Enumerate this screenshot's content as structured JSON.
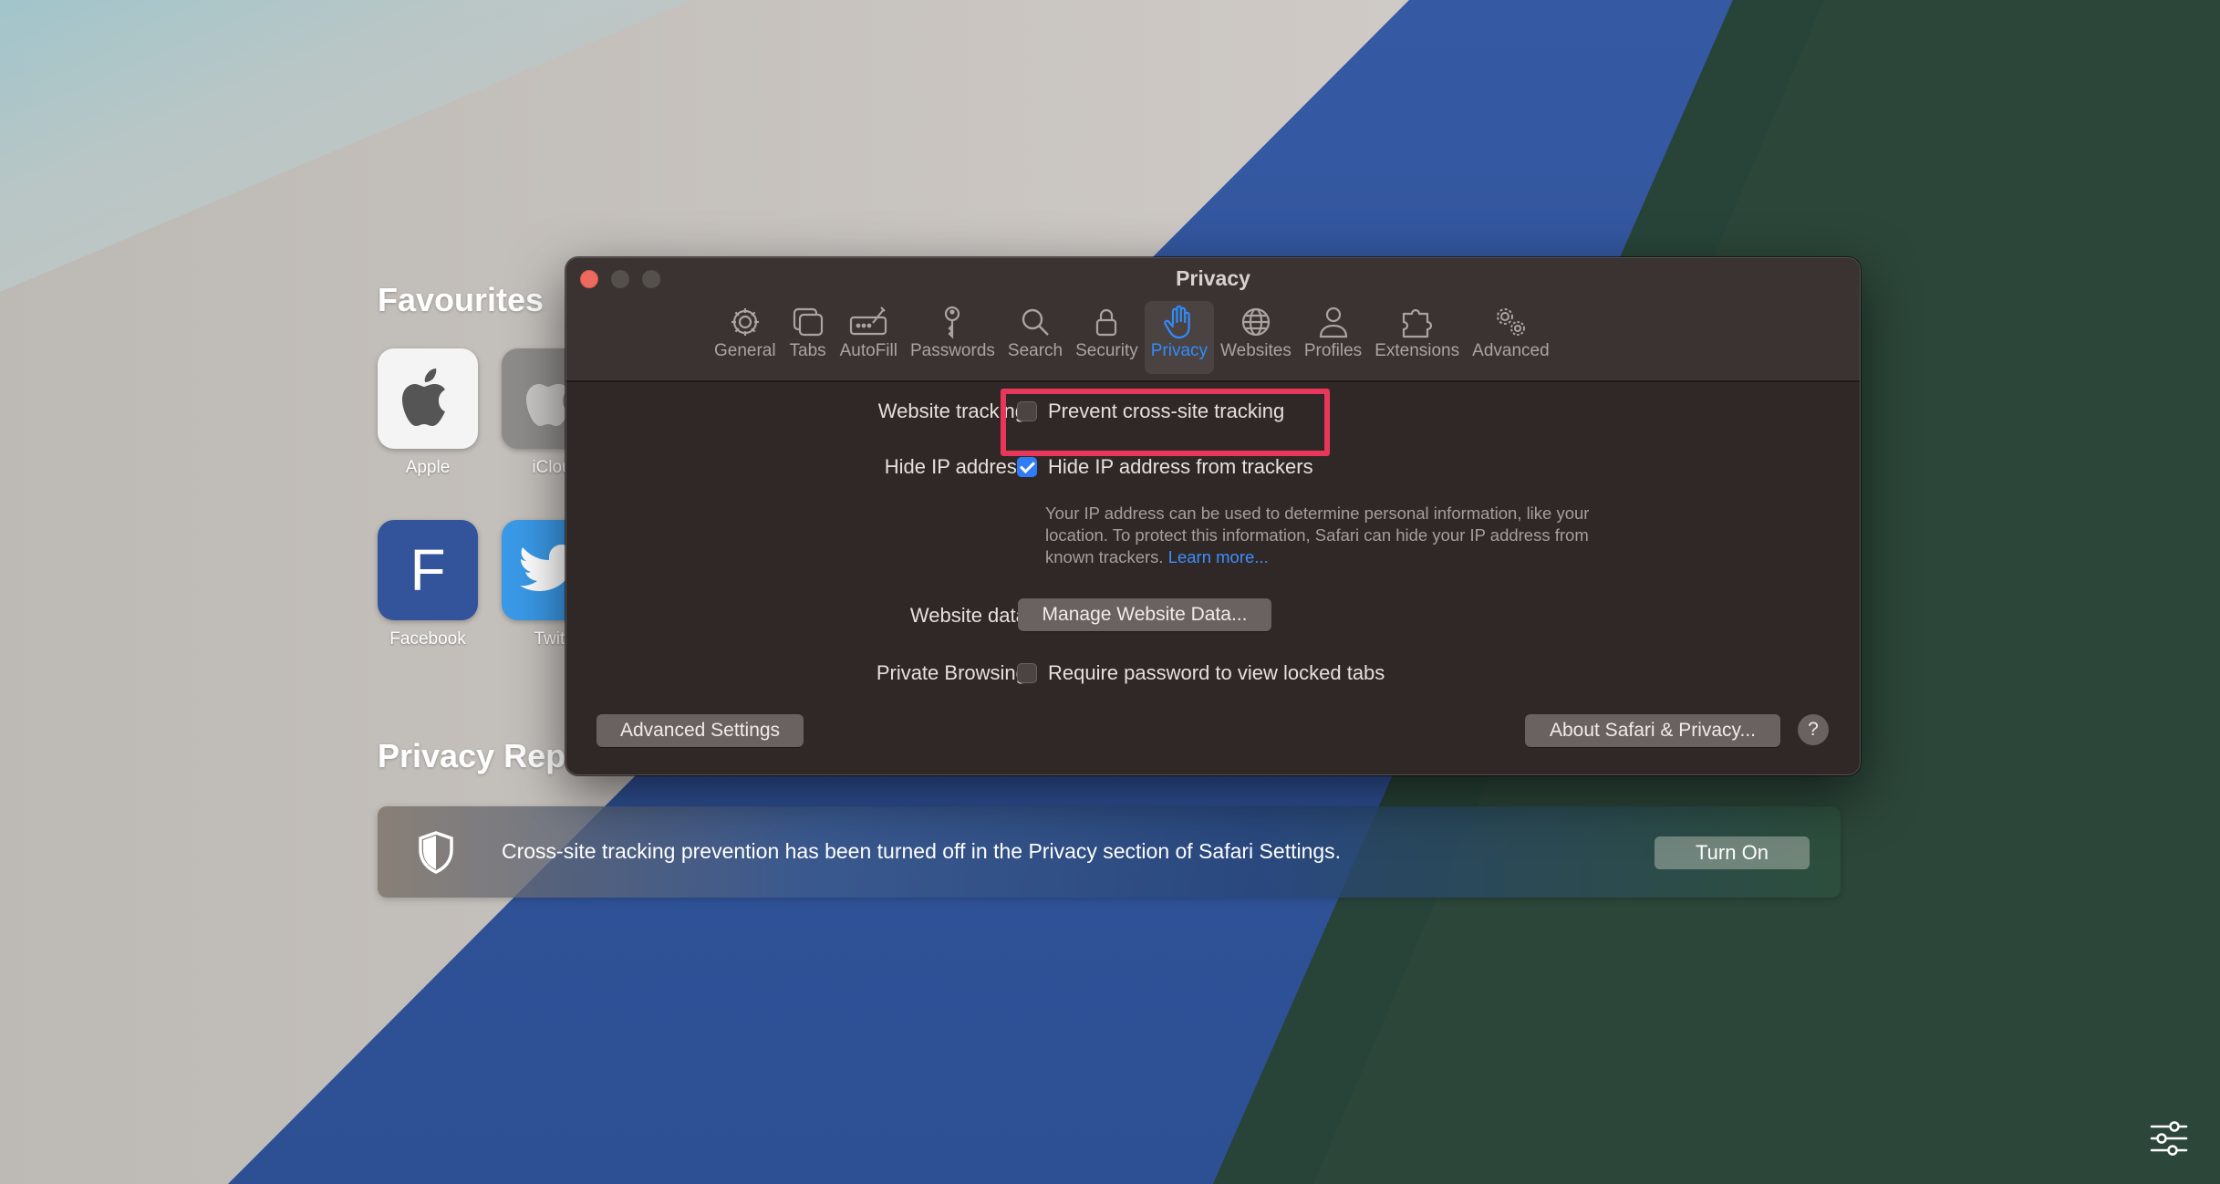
{
  "start_page": {
    "favourites_title": "Favourites",
    "favourites": [
      {
        "label": "Apple",
        "icon": "apple-logo"
      },
      {
        "label": "iClou",
        "icon": "apple-logo"
      },
      {
        "label": "Facebook",
        "letter": "F"
      },
      {
        "label": "Twitt",
        "icon": "bird-logo"
      }
    ],
    "privacy_report_title": "Privacy Rep",
    "report_banner": {
      "text": "Cross-site tracking prevention has been turned off in the Privacy section of Safari Settings.",
      "button": "Turn On"
    }
  },
  "window": {
    "title": "Privacy",
    "toolbar": [
      {
        "label": "General",
        "icon": "gear-icon"
      },
      {
        "label": "Tabs",
        "icon": "tabs-icon"
      },
      {
        "label": "AutoFill",
        "icon": "autofill-icon"
      },
      {
        "label": "Passwords",
        "icon": "key-icon"
      },
      {
        "label": "Search",
        "icon": "magnifier-icon"
      },
      {
        "label": "Security",
        "icon": "lock-icon"
      },
      {
        "label": "Privacy",
        "icon": "hand-icon",
        "active": true
      },
      {
        "label": "Websites",
        "icon": "globe-icon"
      },
      {
        "label": "Profiles",
        "icon": "person-icon"
      },
      {
        "label": "Extensions",
        "icon": "puzzle-icon"
      },
      {
        "label": "Advanced",
        "icon": "gears-icon"
      }
    ],
    "settings": {
      "website_tracking": {
        "label": "Website tracking",
        "option": "Prevent cross-site tracking",
        "checked": false
      },
      "hide_ip": {
        "label": "Hide IP address:",
        "option": "Hide IP address from trackers",
        "checked": true
      },
      "hide_ip_help": "Your IP address can be used to determine personal information, like your location. To protect this information, Safari can hide your IP address from known trackers.",
      "learn_more": "Learn more...",
      "website_data": {
        "label": "Website data:",
        "button": "Manage Website Data..."
      },
      "private_browsing": {
        "label": "Private Browsing:",
        "option": "Require password to view locked tabs",
        "checked": false
      }
    },
    "footer": {
      "advanced_button": "Advanced Settings",
      "about_button": "About Safari & Privacy...",
      "help_button": "?"
    }
  },
  "colors": {
    "accent": "#2f8cff",
    "highlight": "#e8375a",
    "window_bg": "#302826"
  }
}
